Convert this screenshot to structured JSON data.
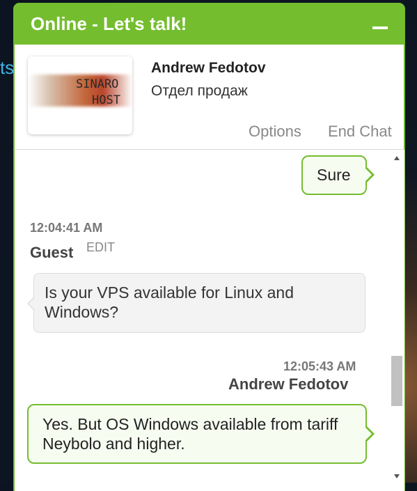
{
  "background": {
    "partial_text": "ts"
  },
  "header": {
    "title": "Online - Let's talk!"
  },
  "agent": {
    "name": "Andrew Fedotov",
    "department": "Отдел продаж",
    "logo": {
      "line1": "SINARO",
      "line2": "HOST"
    }
  },
  "actions": {
    "options": "Options",
    "end_chat": "End Chat"
  },
  "messages": [
    {
      "from": "agent",
      "text": "Sure"
    },
    {
      "from": "guest",
      "time": "12:04:41 AM",
      "sender": "Guest",
      "edit_label": "EDIT",
      "text": "Is your VPS available for Linux and Windows?"
    },
    {
      "from": "agent",
      "time": "12:05:43 AM",
      "sender": "Andrew Fedotov",
      "text": "Yes. But OS Windows available from tariff Neybolo and higher."
    }
  ],
  "colors": {
    "accent": "#74bd2f",
    "agent_bubble": "#f7fcf1",
    "guest_bubble": "#f3f3f3"
  }
}
